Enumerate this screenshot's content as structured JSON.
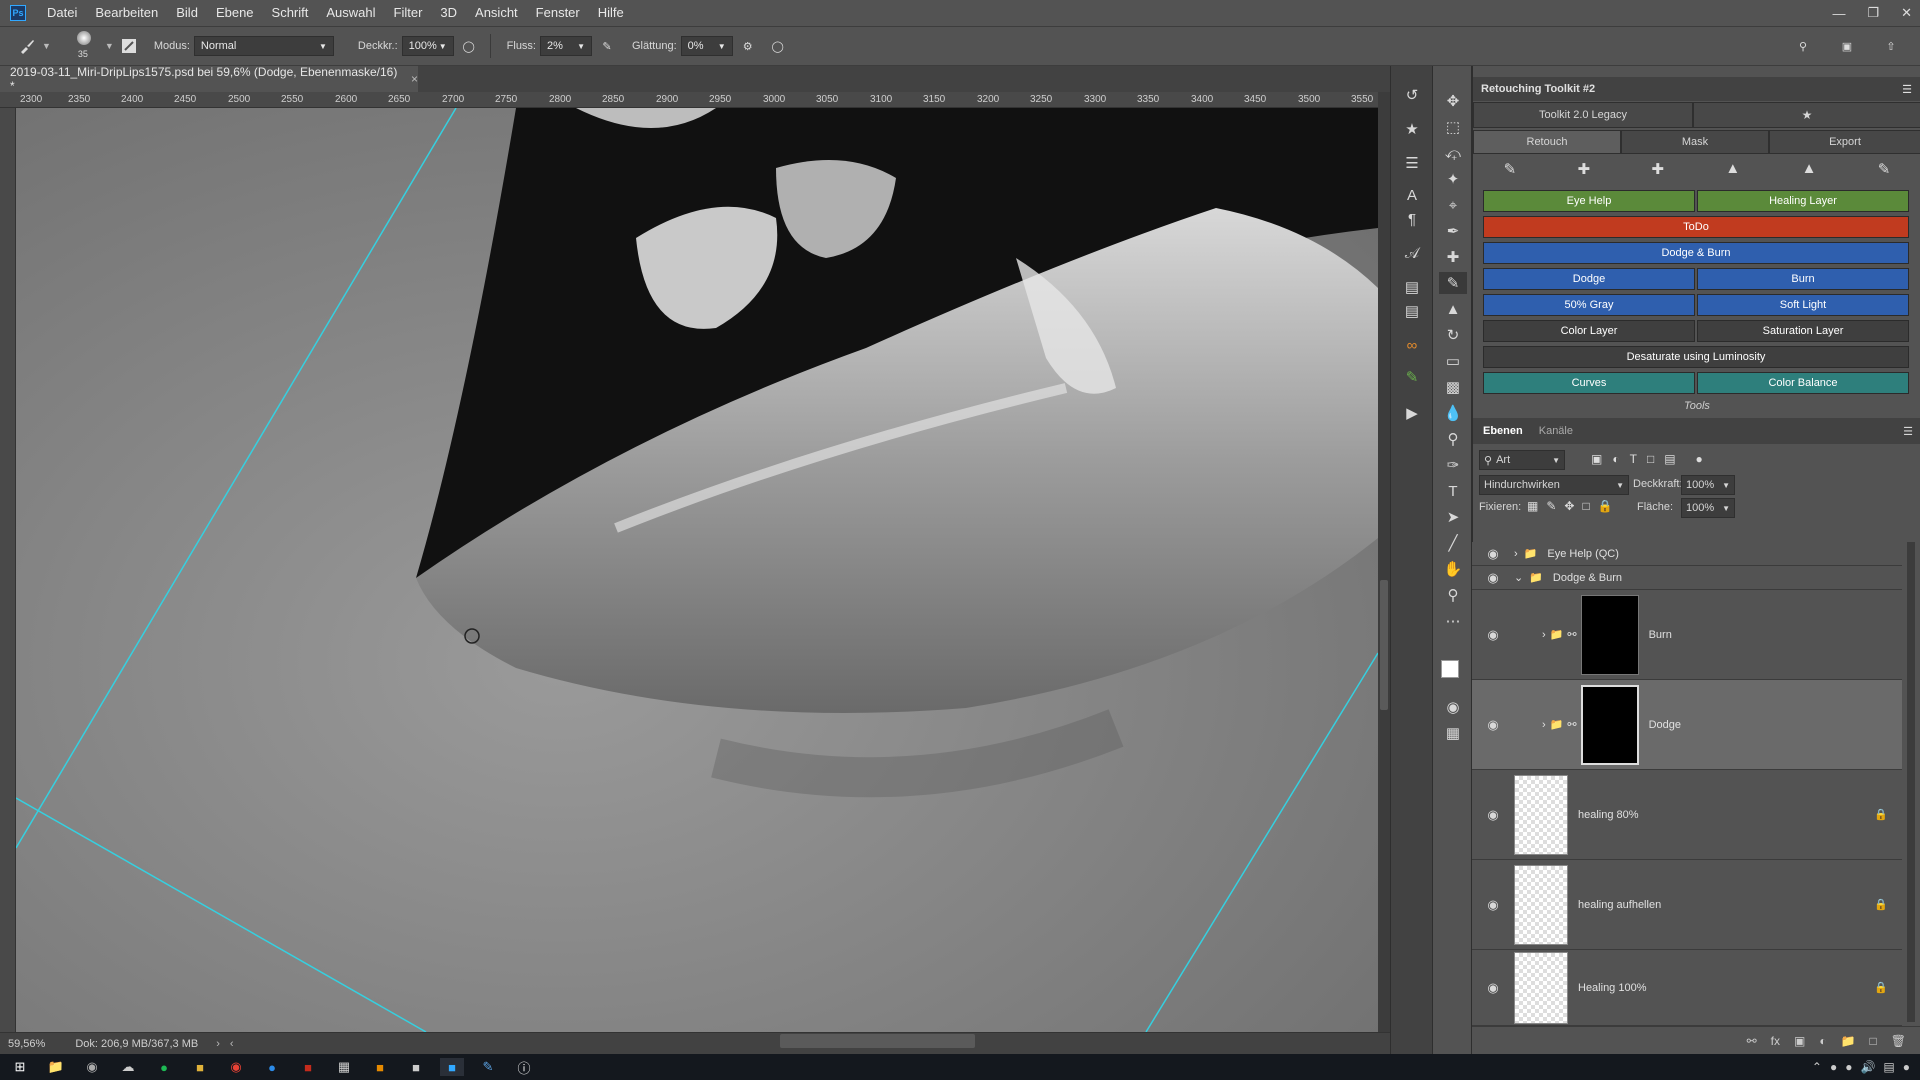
{
  "menubar": {
    "logo": "Ps",
    "items": [
      "Datei",
      "Bearbeiten",
      "Bild",
      "Ebene",
      "Schrift",
      "Auswahl",
      "Filter",
      "3D",
      "Ansicht",
      "Fenster",
      "Hilfe"
    ]
  },
  "options": {
    "brush_size": "35",
    "mode_label": "Modus:",
    "mode_value": "Normal",
    "opacity_label": "Deckkr.:",
    "opacity_value": "100%",
    "flow_label": "Fluss:",
    "flow_value": "2%",
    "smoothing_label": "Glättung:",
    "smoothing_value": "0%"
  },
  "document": {
    "tab_title": "2019-03-11_Miri-DripLips1575.psd bei 59,6% (Dodge, Ebenenmaske/16) *",
    "close": "×"
  },
  "ruler": {
    "ticks": [
      "2300",
      "2350",
      "2400",
      "2450",
      "2500",
      "2550",
      "2600",
      "2650",
      "2700",
      "2750",
      "2800",
      "2850",
      "2900",
      "2950",
      "3000",
      "3050",
      "3100",
      "3150",
      "3200",
      "3250",
      "3300",
      "3350",
      "3400",
      "3450",
      "3500",
      "3550"
    ]
  },
  "status": {
    "zoom": "59,56%",
    "doc_info": "Dok: 206,9 MB/367,3 MB"
  },
  "toolkit": {
    "panel_title": "Retouching Toolkit #2",
    "version_tab": "Toolkit 2.0 Legacy",
    "tabs": [
      "Retouch",
      "Mask",
      "Export"
    ],
    "active_tab": "Retouch",
    "buttons": {
      "eye_help": "Eye Help",
      "healing_layer": "Healing Layer",
      "todo": "ToDo",
      "dodge_burn": "Dodge & Burn",
      "dodge": "Dodge",
      "burn": "Burn",
      "gray50": "50% Gray",
      "soft_light": "Soft Light",
      "color_layer": "Color Layer",
      "saturation_layer": "Saturation Layer",
      "desaturate": "Desaturate using Luminosity",
      "curves": "Curves",
      "color_balance": "Color Balance"
    },
    "tools_label": "Tools",
    "colors": {
      "green": "#5b8a3a",
      "red": "#c13b1f",
      "blue": "#2f5fae",
      "dark": "#3f3f3f",
      "teal": "#2e7f7c"
    }
  },
  "layers": {
    "tabs": [
      "Ebenen",
      "Kanäle"
    ],
    "filter_label": "Art",
    "blend_mode": "Hindurchwirken",
    "opacity_label": "Deckkraft:",
    "opacity_value": "100%",
    "lock_label": "Fixieren:",
    "fill_label": "Fläche:",
    "fill_value": "100%",
    "items": [
      {
        "name": "Eye Help (QC)"
      },
      {
        "name": "Dodge & Burn"
      },
      {
        "name": "Burn"
      },
      {
        "name": "Dodge"
      },
      {
        "name": "healing 80%"
      },
      {
        "name": "healing aufhellen"
      },
      {
        "name": "Healing 100%"
      }
    ]
  }
}
